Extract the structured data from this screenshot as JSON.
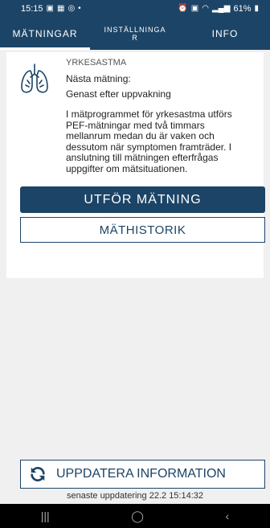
{
  "status_bar": {
    "time": "15:15",
    "battery": "61%",
    "left_icons": [
      "image-icon",
      "calendar-icon",
      "whatsapp-icon",
      "dot-icon"
    ],
    "right_icons": [
      "alarm-icon",
      "notification-icon",
      "wifi-icon",
      "volte-icon",
      "signal-icon",
      "battery-icon"
    ]
  },
  "tabs": [
    {
      "label": "MÄTNINGAR",
      "active": true
    },
    {
      "label_line1": "INSTÄLLNINGA",
      "label_line2": "R",
      "active": false
    },
    {
      "label": "INFO",
      "active": false
    }
  ],
  "program": {
    "title": "YRKESASTMA",
    "next_label": "Nästa mätning:",
    "next_value": "Genast efter uppvakning",
    "description": "I mätprogrammet för yrkesastma utförs PEF-mätningar med två timmars mellanrum medan du är vaken och dessutom när symptomen framträder. I anslutning till mätningen efterfrågas uppgifter om mätsituationen.",
    "icon": "lungs-icon"
  },
  "buttons": {
    "measure": "UTFÖR MÄTNING",
    "history": "MÄTHISTORIK",
    "update": "UPPDATERA INFORMATION"
  },
  "last_update": "senaste uppdatering 22.2 15:14:32",
  "nav": {
    "recents": "|||",
    "home": "◯",
    "back": "‹"
  },
  "colors": {
    "primary": "#1c4466",
    "background": "#f0f0f0",
    "card": "#ffffff"
  }
}
